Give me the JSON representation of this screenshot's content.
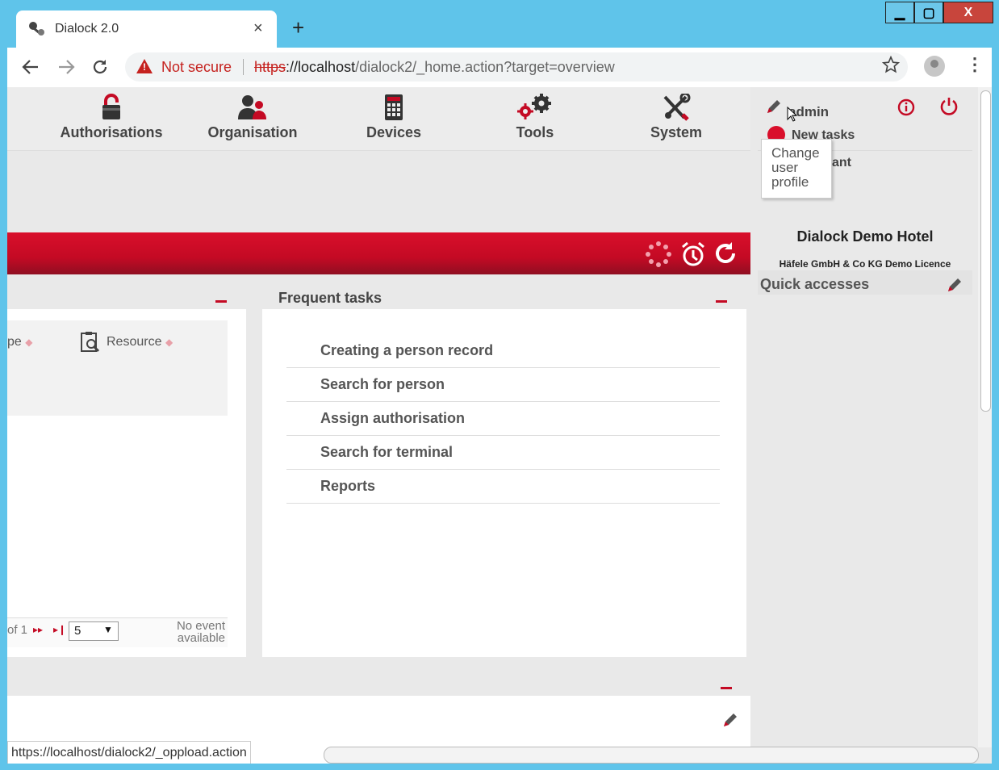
{
  "browser": {
    "tab_title": "Dialock 2.0",
    "tab_close": "×",
    "new_tab": "+",
    "not_secure": "Not secure",
    "url_scheme": "https",
    "url_host": "://localhost",
    "url_path": "/dialock2/_home.action?target=overview",
    "status_url": "https://localhost/dialock2/_oppload.action"
  },
  "window_controls": {
    "minimize": "▁",
    "maximize": "▢",
    "close": "X"
  },
  "menu": [
    {
      "label": "Authorisations",
      "icon": "padlock-icon"
    },
    {
      "label": "Organisation",
      "icon": "people-icon"
    },
    {
      "label": "Devices",
      "icon": "keypad-device-icon"
    },
    {
      "label": "Tools",
      "icon": "gears-icon"
    },
    {
      "label": "System",
      "icon": "wrench-screwdriver-icon"
    }
  ],
  "user": {
    "name": "admin",
    "new_tasks": "New tasks",
    "assistant_fragment": "ant",
    "tooltip": "Change user profile"
  },
  "hotel": {
    "name": "Dialock Demo Hotel",
    "licence": "Häfele GmbH & Co KG Demo Licence"
  },
  "quick_accesses": {
    "title": "Quick accesses"
  },
  "events_panel": {
    "col_type_fragment": "pe",
    "col_resource": "Resource",
    "pager_of": "of 1",
    "page_size": "5",
    "no_event_line1": "No event",
    "no_event_line2": "available"
  },
  "frequent_tasks": {
    "title": "Frequent tasks",
    "items": [
      "Creating a person record",
      "Search for person",
      "Assign authorisation",
      "Search for terminal",
      "Reports"
    ]
  },
  "colors": {
    "brand_red": "#c40a24",
    "page_bg": "#e9e9e9",
    "chrome_bg": "#5fc4ea"
  }
}
